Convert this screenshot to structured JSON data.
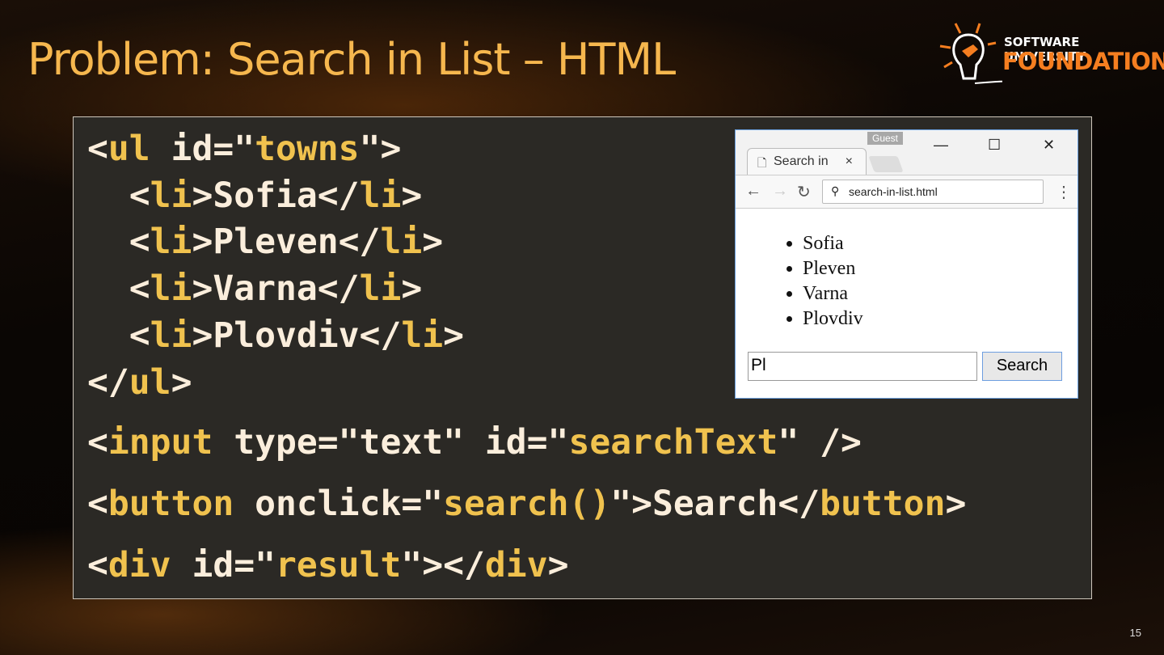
{
  "title": "Problem: Search in List – HTML",
  "logo": {
    "line1": "SOFTWARE UNIVERSITY",
    "line2": "FOUNDATION"
  },
  "code": [
    [
      {
        "k": "p",
        "s": "<"
      },
      {
        "k": "t",
        "s": "ul"
      },
      {
        "k": "p",
        "s": " id=\""
      },
      {
        "k": "v",
        "s": "towns"
      },
      {
        "k": "p",
        "s": "\">"
      }
    ],
    [
      {
        "k": "p",
        "s": "  <"
      },
      {
        "k": "t",
        "s": "li"
      },
      {
        "k": "p",
        "s": ">Sofia</"
      },
      {
        "k": "t",
        "s": "li"
      },
      {
        "k": "p",
        "s": ">"
      }
    ],
    [
      {
        "k": "p",
        "s": "  <"
      },
      {
        "k": "t",
        "s": "li"
      },
      {
        "k": "p",
        "s": ">Pleven</"
      },
      {
        "k": "t",
        "s": "li"
      },
      {
        "k": "p",
        "s": ">"
      }
    ],
    [
      {
        "k": "p",
        "s": "  <"
      },
      {
        "k": "t",
        "s": "li"
      },
      {
        "k": "p",
        "s": ">Varna</"
      },
      {
        "k": "t",
        "s": "li"
      },
      {
        "k": "p",
        "s": ">"
      }
    ],
    [
      {
        "k": "p",
        "s": "  <"
      },
      {
        "k": "t",
        "s": "li"
      },
      {
        "k": "p",
        "s": ">Plovdiv</"
      },
      {
        "k": "t",
        "s": "li"
      },
      {
        "k": "p",
        "s": ">"
      }
    ],
    [
      {
        "k": "p",
        "s": "</"
      },
      {
        "k": "t",
        "s": "ul"
      },
      {
        "k": "p",
        "s": ">"
      }
    ],
    [
      {
        "k": "p",
        "s": "<"
      },
      {
        "k": "t",
        "s": "input"
      },
      {
        "k": "p",
        "s": " type=\"text\" id=\""
      },
      {
        "k": "v",
        "s": "searchText"
      },
      {
        "k": "p",
        "s": "\" />"
      }
    ],
    [
      {
        "k": "p",
        "s": "<"
      },
      {
        "k": "t",
        "s": "button"
      },
      {
        "k": "p",
        "s": " onclick=\""
      },
      {
        "k": "v",
        "s": "search()"
      },
      {
        "k": "p",
        "s": "\">Search</"
      },
      {
        "k": "t",
        "s": "button"
      },
      {
        "k": "p",
        "s": ">"
      }
    ],
    [
      {
        "k": "p",
        "s": "<"
      },
      {
        "k": "t",
        "s": "div"
      },
      {
        "k": "p",
        "s": " id=\""
      },
      {
        "k": "v",
        "s": "result"
      },
      {
        "k": "p",
        "s": "\"></"
      },
      {
        "k": "t",
        "s": "div"
      },
      {
        "k": "p",
        "s": ">"
      }
    ]
  ],
  "browser": {
    "profile": "Guest",
    "tab_title": "Search in",
    "tab_close": "×",
    "minimize": "—",
    "maximize": "☐",
    "close": "✕",
    "back": "←",
    "forward": "→",
    "reload": "↻",
    "url": "search-in-list.html",
    "menu": "⋮",
    "towns": [
      "Sofia",
      "Pleven",
      "Varna",
      "Plovdiv"
    ],
    "search_value": "Pl",
    "search_button": "Search"
  },
  "page_number": "15"
}
